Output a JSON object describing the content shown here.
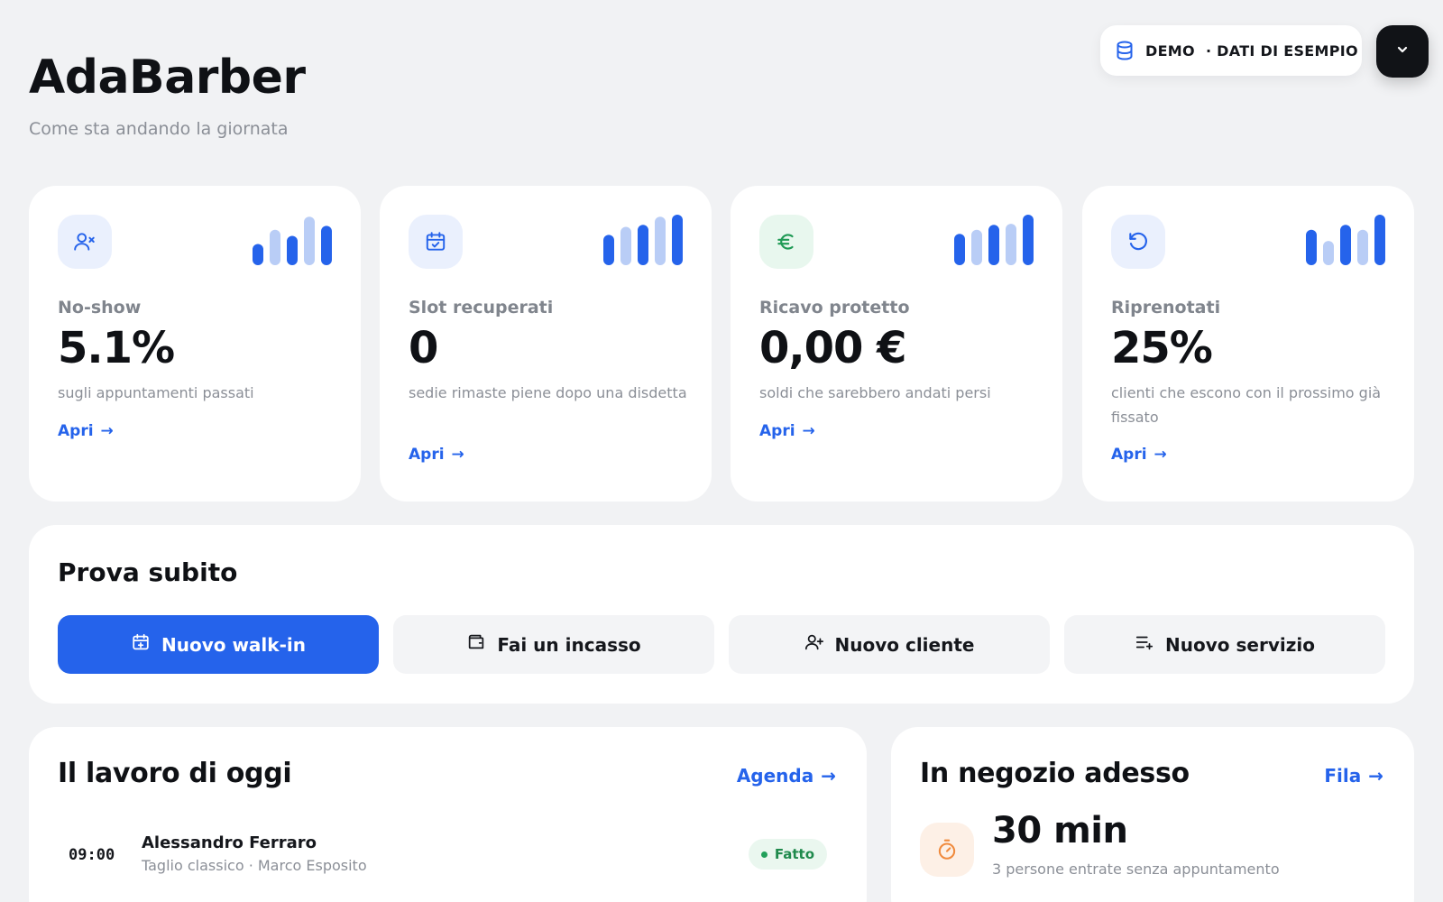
{
  "header": {
    "brand": "AdaBarber",
    "tagline": "Come sta andando la giornata",
    "demo_label": "DEMO",
    "demo_note": "· DATI DI ESEMPIO"
  },
  "kpis": [
    {
      "label": "No-show",
      "value": "5.1%",
      "sub": "sugli appuntamenti passati",
      "link": "Apri",
      "icon": "user-x-icon"
    },
    {
      "label": "Slot recuperati",
      "value": "0",
      "sub": "sedie rimaste piene dopo una disdetta",
      "link": "Apri",
      "icon": "calendar-check-icon"
    },
    {
      "label": "Ricavo protetto",
      "value": "0,00 €",
      "sub": "soldi che sarebbero andati persi",
      "link": "Apri",
      "icon": "euro-icon"
    },
    {
      "label": "Riprenotati",
      "value": "25%",
      "sub": "clienti che escono con il prossimo già fissato",
      "link": "Apri",
      "icon": "rotate-ccw-icon"
    }
  ],
  "quick_actions": {
    "title": "Prova subito",
    "buttons": [
      {
        "label": "Nuovo walk-in",
        "icon": "calendar-plus-icon"
      },
      {
        "label": "Fai un incasso",
        "icon": "wallet-icon"
      },
      {
        "label": "Nuovo cliente",
        "icon": "user-plus-icon"
      },
      {
        "label": "Nuovo servizio",
        "icon": "list-plus-icon"
      }
    ]
  },
  "today": {
    "title": "Il lavoro di oggi",
    "link": "Agenda",
    "rows": [
      {
        "time": "09:00",
        "name": "Alessandro Ferraro",
        "meta": "Taglio classico · Marco Esposito",
        "status": "Fatto"
      }
    ]
  },
  "in_shop": {
    "title": "In negozio adesso",
    "link": "Fila",
    "value": "30 min",
    "sub": "3 persone entrate senza appuntamento",
    "icon": "timer-icon"
  },
  "colors": {
    "accent": "#2563eb",
    "bar_light": "#b9cdf6",
    "success": "#22a05a",
    "timer": "#f08a3c"
  }
}
